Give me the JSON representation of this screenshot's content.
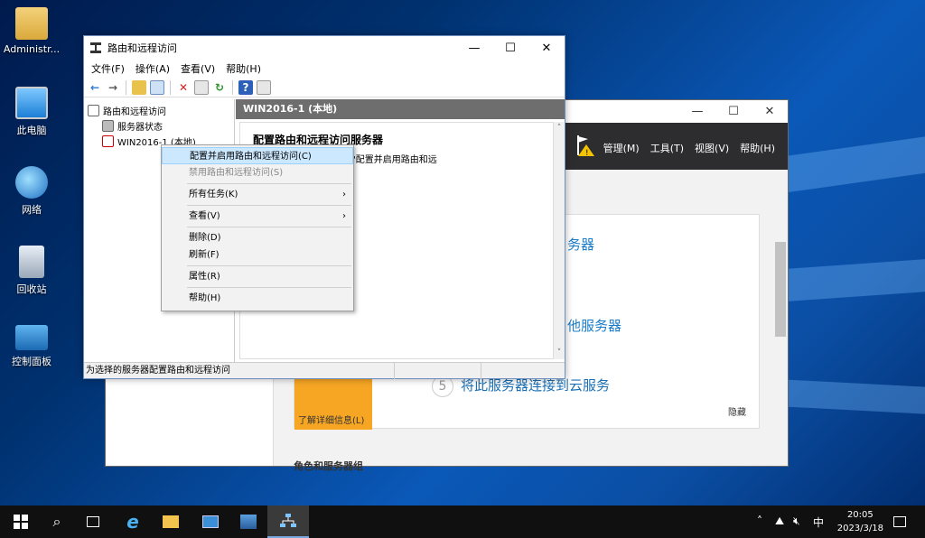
{
  "desktop": {
    "icons": [
      {
        "label": "Administr...",
        "icon": "user-folder-icon"
      },
      {
        "label": "此电脑",
        "icon": "computer-icon"
      },
      {
        "label": "网络",
        "icon": "network-icon"
      },
      {
        "label": "回收站",
        "icon": "recycle-bin-icon"
      },
      {
        "label": "控制面板",
        "icon": "control-panel-icon"
      }
    ]
  },
  "server_manager": {
    "menu": [
      "管理(M)",
      "工具(T)",
      "视图(V)",
      "帮助(H)"
    ],
    "partial_1": "务器",
    "partial_2": "他服务器",
    "step5_num": "5",
    "step5_label": "将此服务器连接到云服务",
    "learn_more": "了解详细信息(L)",
    "hide": "隐藏",
    "roles_label": "角色和服务器组"
  },
  "rras": {
    "title": "路由和远程访问",
    "menu": [
      "文件(F)",
      "操作(A)",
      "查看(V)",
      "帮助(H)"
    ],
    "tree": {
      "root": "路由和远程访问",
      "status": "服务器状态",
      "server": "WIN2016-1 (本地)"
    },
    "right_header": "WIN2016-1 (本地)",
    "heading": "配置路由和远程访问服务器",
    "body_text": "，请在\"操作\"菜单上单击\"配置并启用路由和远",
    "status_text": "为选择的服务器配置路由和远程访问"
  },
  "context_menu": {
    "items": [
      {
        "label": "配置并启用路由和远程访问(C)",
        "state": "highlighted"
      },
      {
        "label": "禁用路由和远程访问(S)",
        "state": "disabled"
      },
      {
        "label": "所有任务(K)",
        "submenu": true
      },
      {
        "label": "查看(V)",
        "submenu": true
      },
      {
        "label": "删除(D)"
      },
      {
        "label": "刷新(F)"
      },
      {
        "label": "属性(R)"
      },
      {
        "label": "帮助(H)"
      }
    ]
  },
  "taskbar": {
    "time": "20:05",
    "date": "2023/3/18",
    "ime": "中"
  },
  "colors": {
    "accent": "#1a7cc9",
    "orange_tile": "#f6a623",
    "highlight": "#cce8ff"
  }
}
